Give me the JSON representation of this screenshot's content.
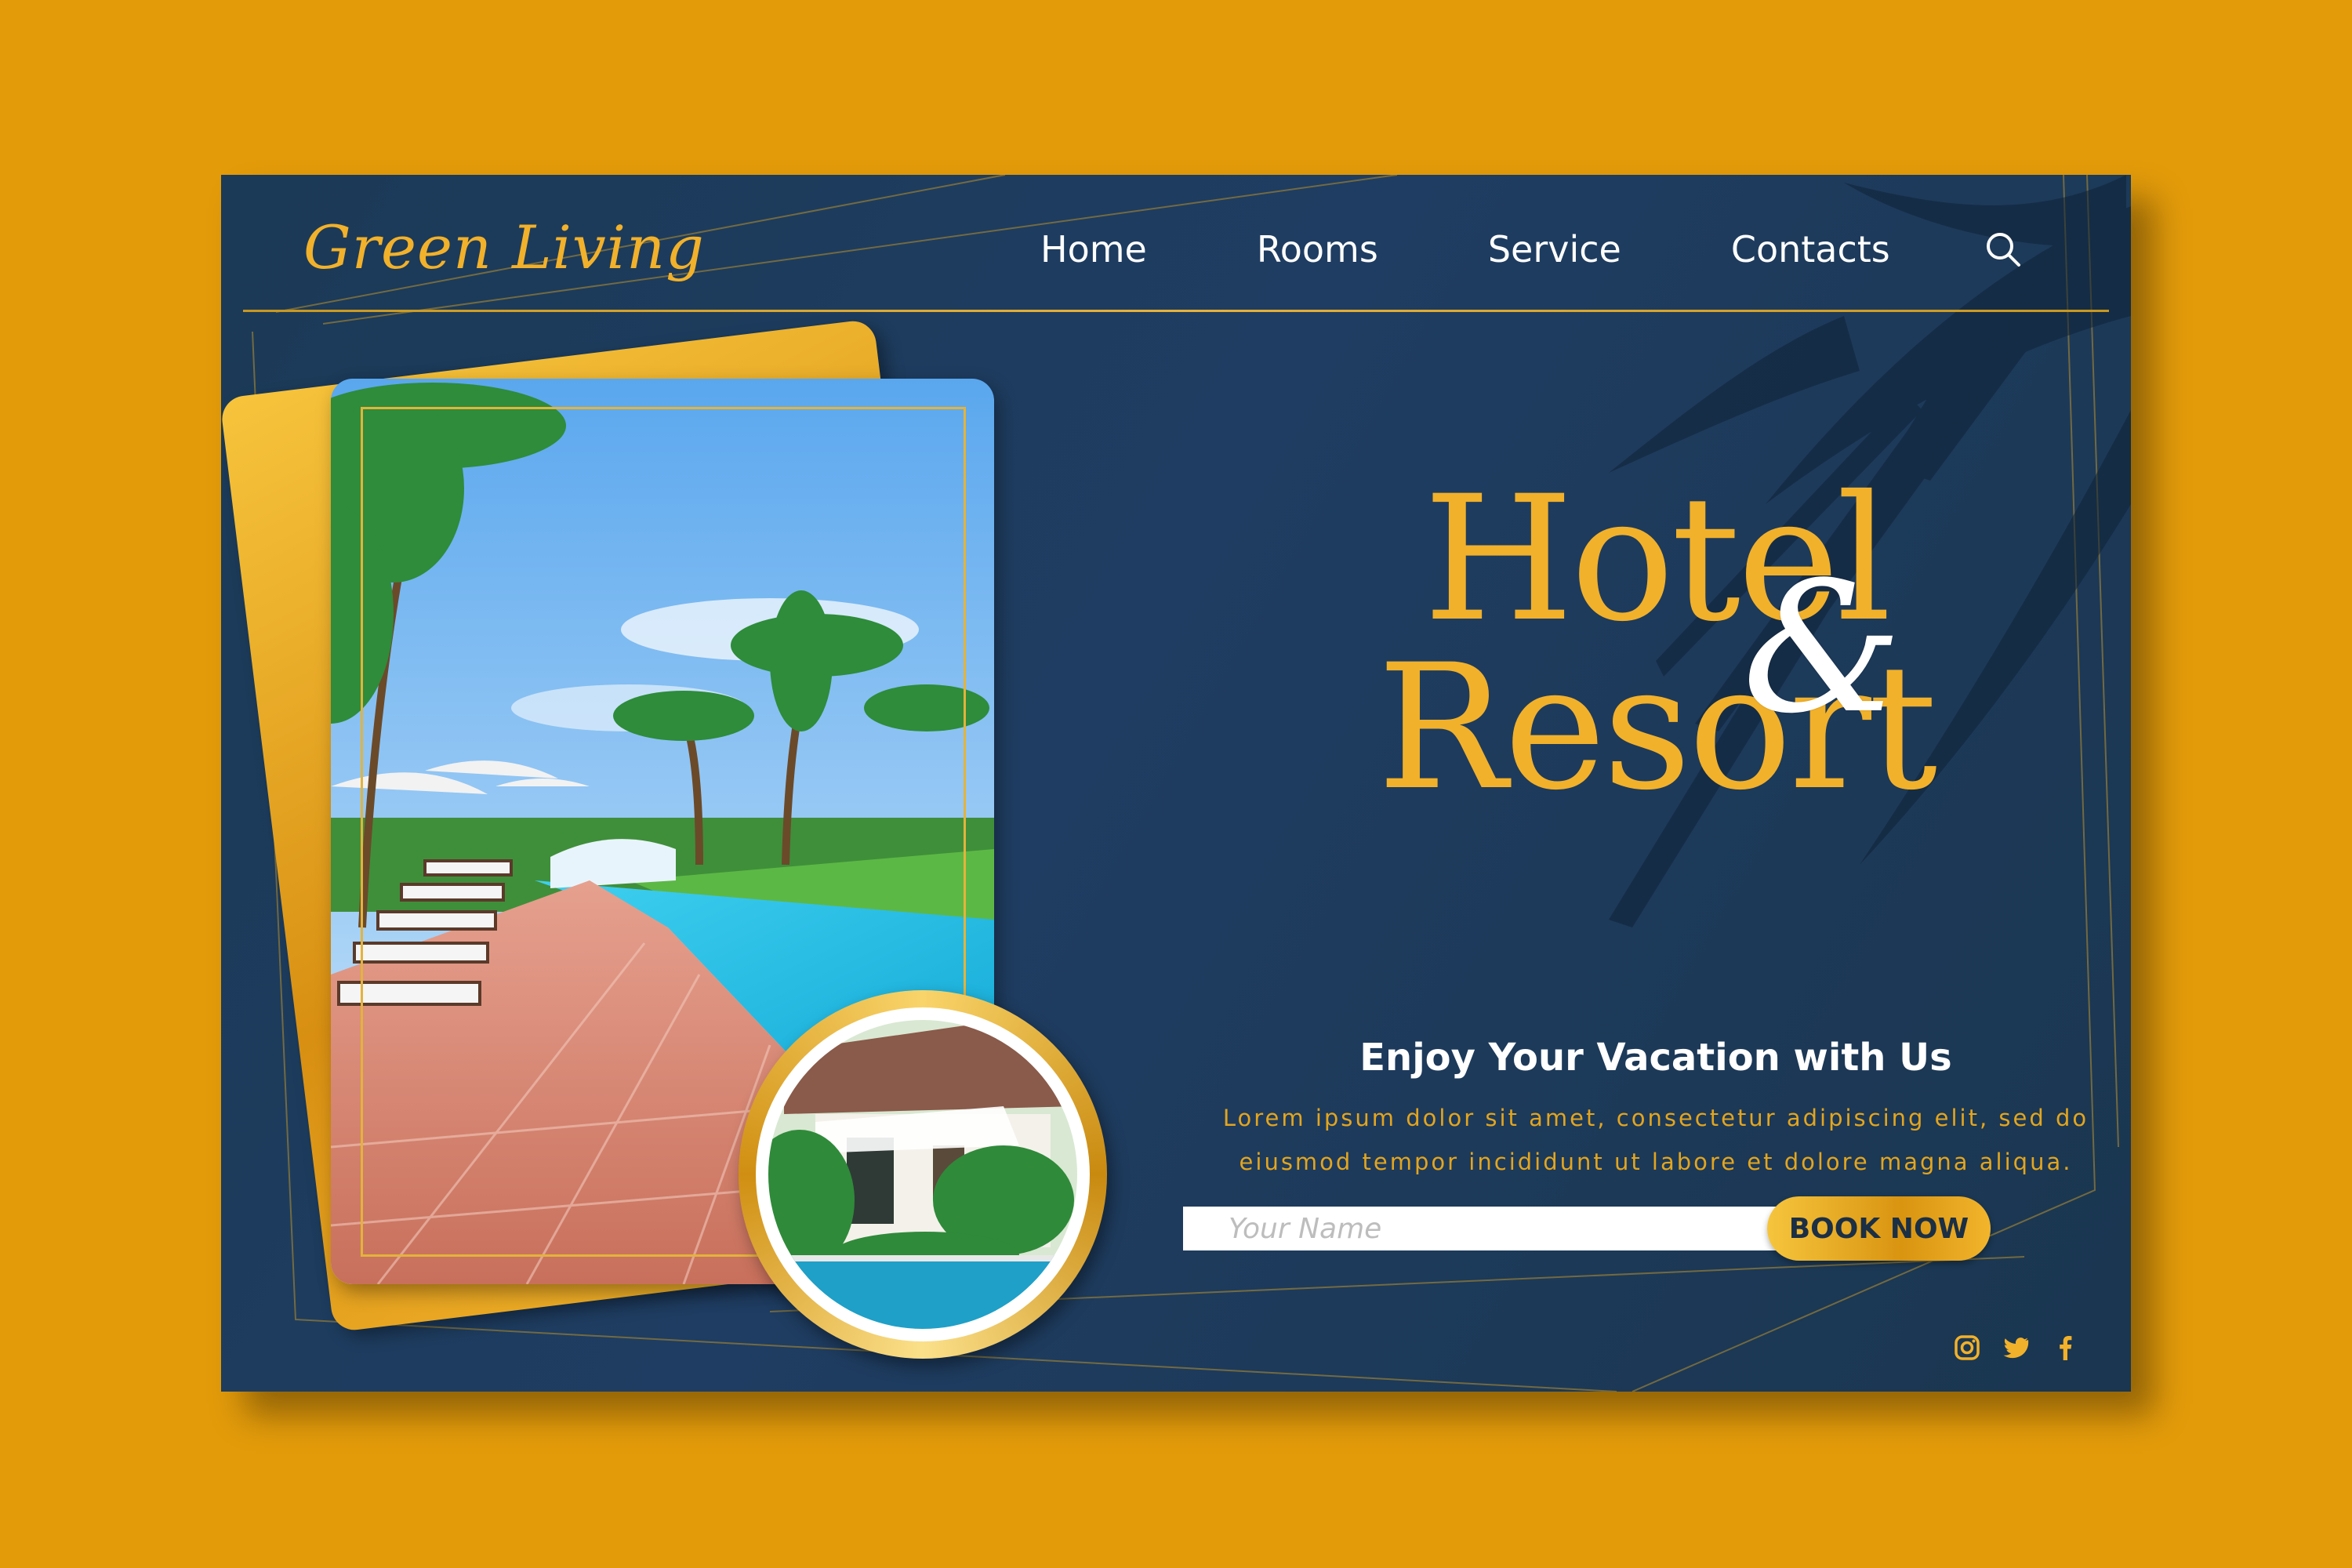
{
  "brand": {
    "logo_text": "Green Living"
  },
  "nav": {
    "items": [
      "Home",
      "Rooms",
      "Service",
      "Contacts"
    ]
  },
  "hero": {
    "line1": "Hotel",
    "ampersand": "&",
    "line2": "Resort"
  },
  "booking": {
    "tagline": "Enjoy Your Vacation with Us",
    "description_line1": "Lorem ipsum dolor sit amet, consectetur adipiscing elit, sed do",
    "description_line2": "eiusmod tempor incididunt ut labore et dolore magna aliqua.",
    "name_placeholder": "Your Name",
    "button_label": "BOOK NOW"
  },
  "social": {
    "icons": [
      "instagram-icon",
      "twitter-icon",
      "facebook-icon"
    ]
  },
  "colors": {
    "background": "#E39B0A",
    "card": "#1d3a5a",
    "accent_gold": "#F2B12A",
    "text_white": "#FFFFFF"
  }
}
